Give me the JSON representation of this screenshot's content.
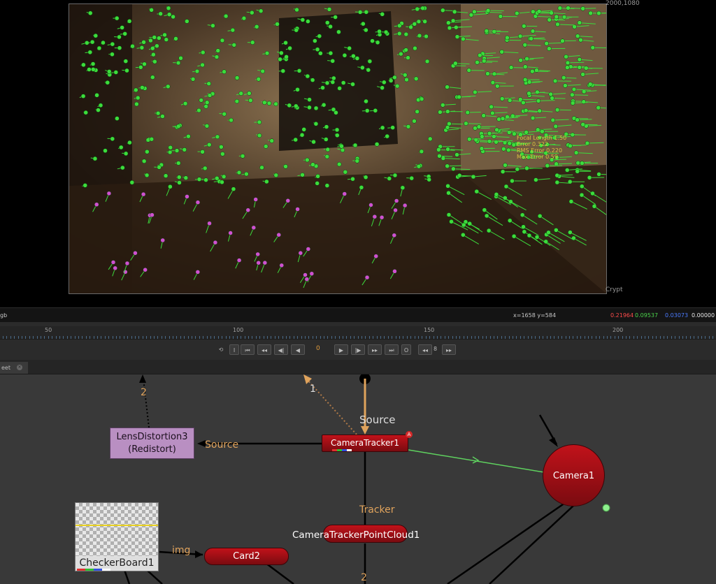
{
  "viewer": {
    "format_label": "2000,1080",
    "channel_label": "Crypt",
    "overlay_text": [
      "Focal Length 1.50",
      "Error 0.322",
      "RMS Error 0.220",
      "Max Error 0.59"
    ]
  },
  "infobar": {
    "channels": "gb",
    "coords": "x=1658 y=584",
    "r": "0.21964",
    "g": "0.09537",
    "b": "0.03073",
    "a": "0.00000"
  },
  "timeline": {
    "ticks": [
      "50",
      "100",
      "150",
      "200"
    ],
    "frame_value": "0",
    "step_value": "8"
  },
  "tab": {
    "label": "eet"
  },
  "graph": {
    "nodes": {
      "lens_distortion": "LensDistortion3\n(Redistort)",
      "camera_tracker": "CameraTracker1",
      "camera": "Camera1",
      "point_cloud": "CameraTrackerPointCloud1",
      "card": "Card2",
      "checkerboard": "CheckerBoard1"
    },
    "labels": {
      "source_top": "Source",
      "source_left": "Source",
      "tracker": "Tracker",
      "img": "img",
      "num_2_top": "2",
      "num_1": "1",
      "num_2_bottom": "2"
    },
    "camera_tracker_badge": "A"
  },
  "colors": {
    "node_red": "#b0121a",
    "lens_purple": "#b98fc2",
    "track_green": "#3cdc3c",
    "track_magenta": "#d050d0",
    "orange_label": "#e0a35c"
  }
}
